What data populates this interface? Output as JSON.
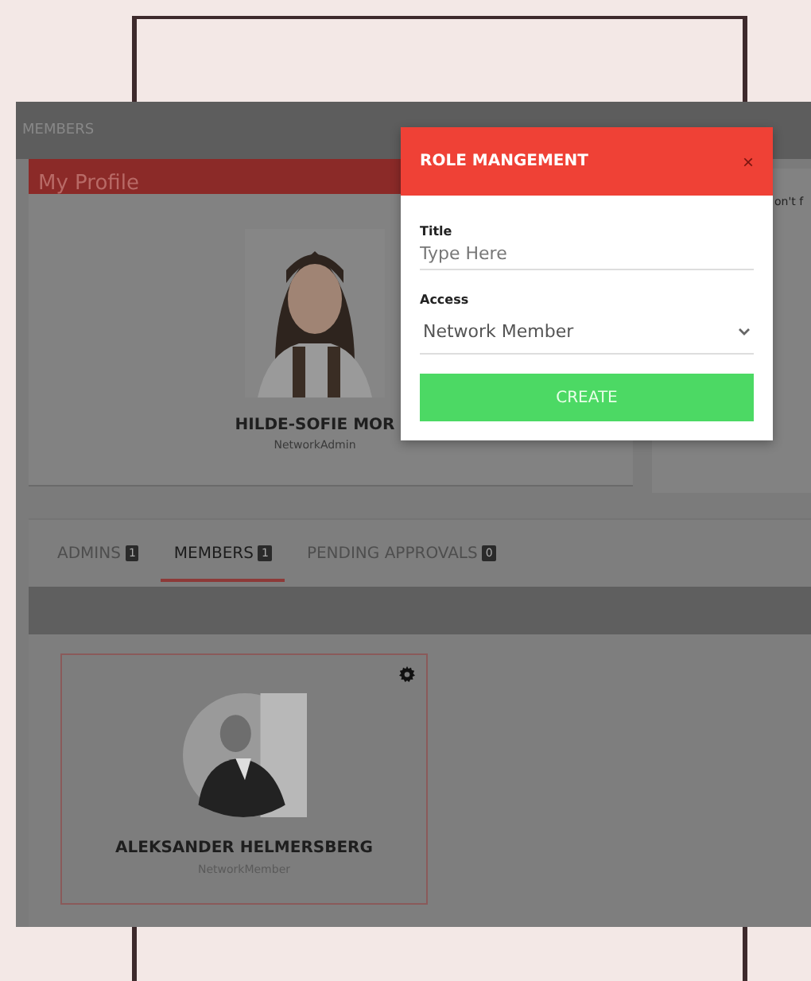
{
  "top_bar": {
    "title": "MEMBERS"
  },
  "profile": {
    "heading": "My Profile",
    "name": "HILDE-SOFIE MOR",
    "role": "NetworkAdmin"
  },
  "side_card": {
    "text": "on't f"
  },
  "tabs": [
    {
      "label": "ADMINS",
      "badge": "1",
      "selected": false
    },
    {
      "label": "MEMBERS",
      "badge": "1",
      "selected": true
    },
    {
      "label": "PENDING APPROVALS",
      "badge": "0",
      "selected": false
    }
  ],
  "members": [
    {
      "name": "ALEKSANDER HELMERSBERG",
      "role": "NetworkMember"
    }
  ],
  "modal": {
    "title": "ROLE MANGEMENT",
    "close": "×",
    "title_field": {
      "label": "Title",
      "placeholder": "Type Here"
    },
    "access_field": {
      "label": "Access",
      "value": "Network Member"
    },
    "button": "CREATE"
  }
}
